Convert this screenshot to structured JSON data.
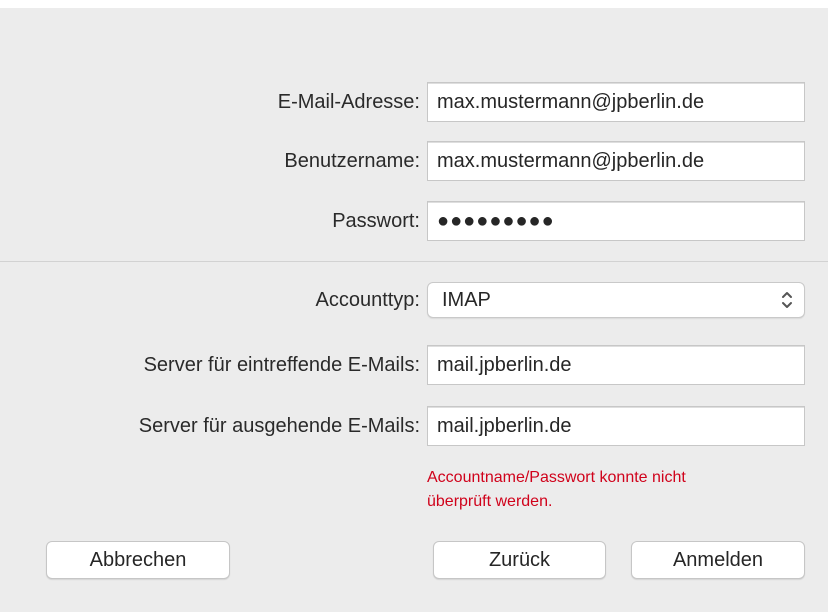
{
  "form": {
    "email": {
      "label": "E-Mail-Adresse:",
      "value": "max.mustermann@jpberlin.de"
    },
    "username": {
      "label": "Benutzername:",
      "value": "max.mustermann@jpberlin.de"
    },
    "password": {
      "label": "Passwort:",
      "value": "●●●●●●●●●"
    },
    "account_type": {
      "label": "Accounttyp:",
      "value": "IMAP"
    },
    "incoming_server": {
      "label": "Server für eintreffende E-Mails:",
      "value": "mail.jpberlin.de"
    },
    "outgoing_server": {
      "label": "Server für ausgehende E-Mails:",
      "value": "mail.jpberlin.de"
    },
    "error_line1": "Accountname/Passwort konnte nicht",
    "error_line2": "überprüft werden."
  },
  "buttons": {
    "cancel": "Abbrechen",
    "back": "Zurück",
    "sign_in": "Anmelden"
  },
  "colors": {
    "error": "#d0021b",
    "background": "#ececec"
  },
  "icons": {
    "account_type_select": "chevron-up-down-icon"
  }
}
